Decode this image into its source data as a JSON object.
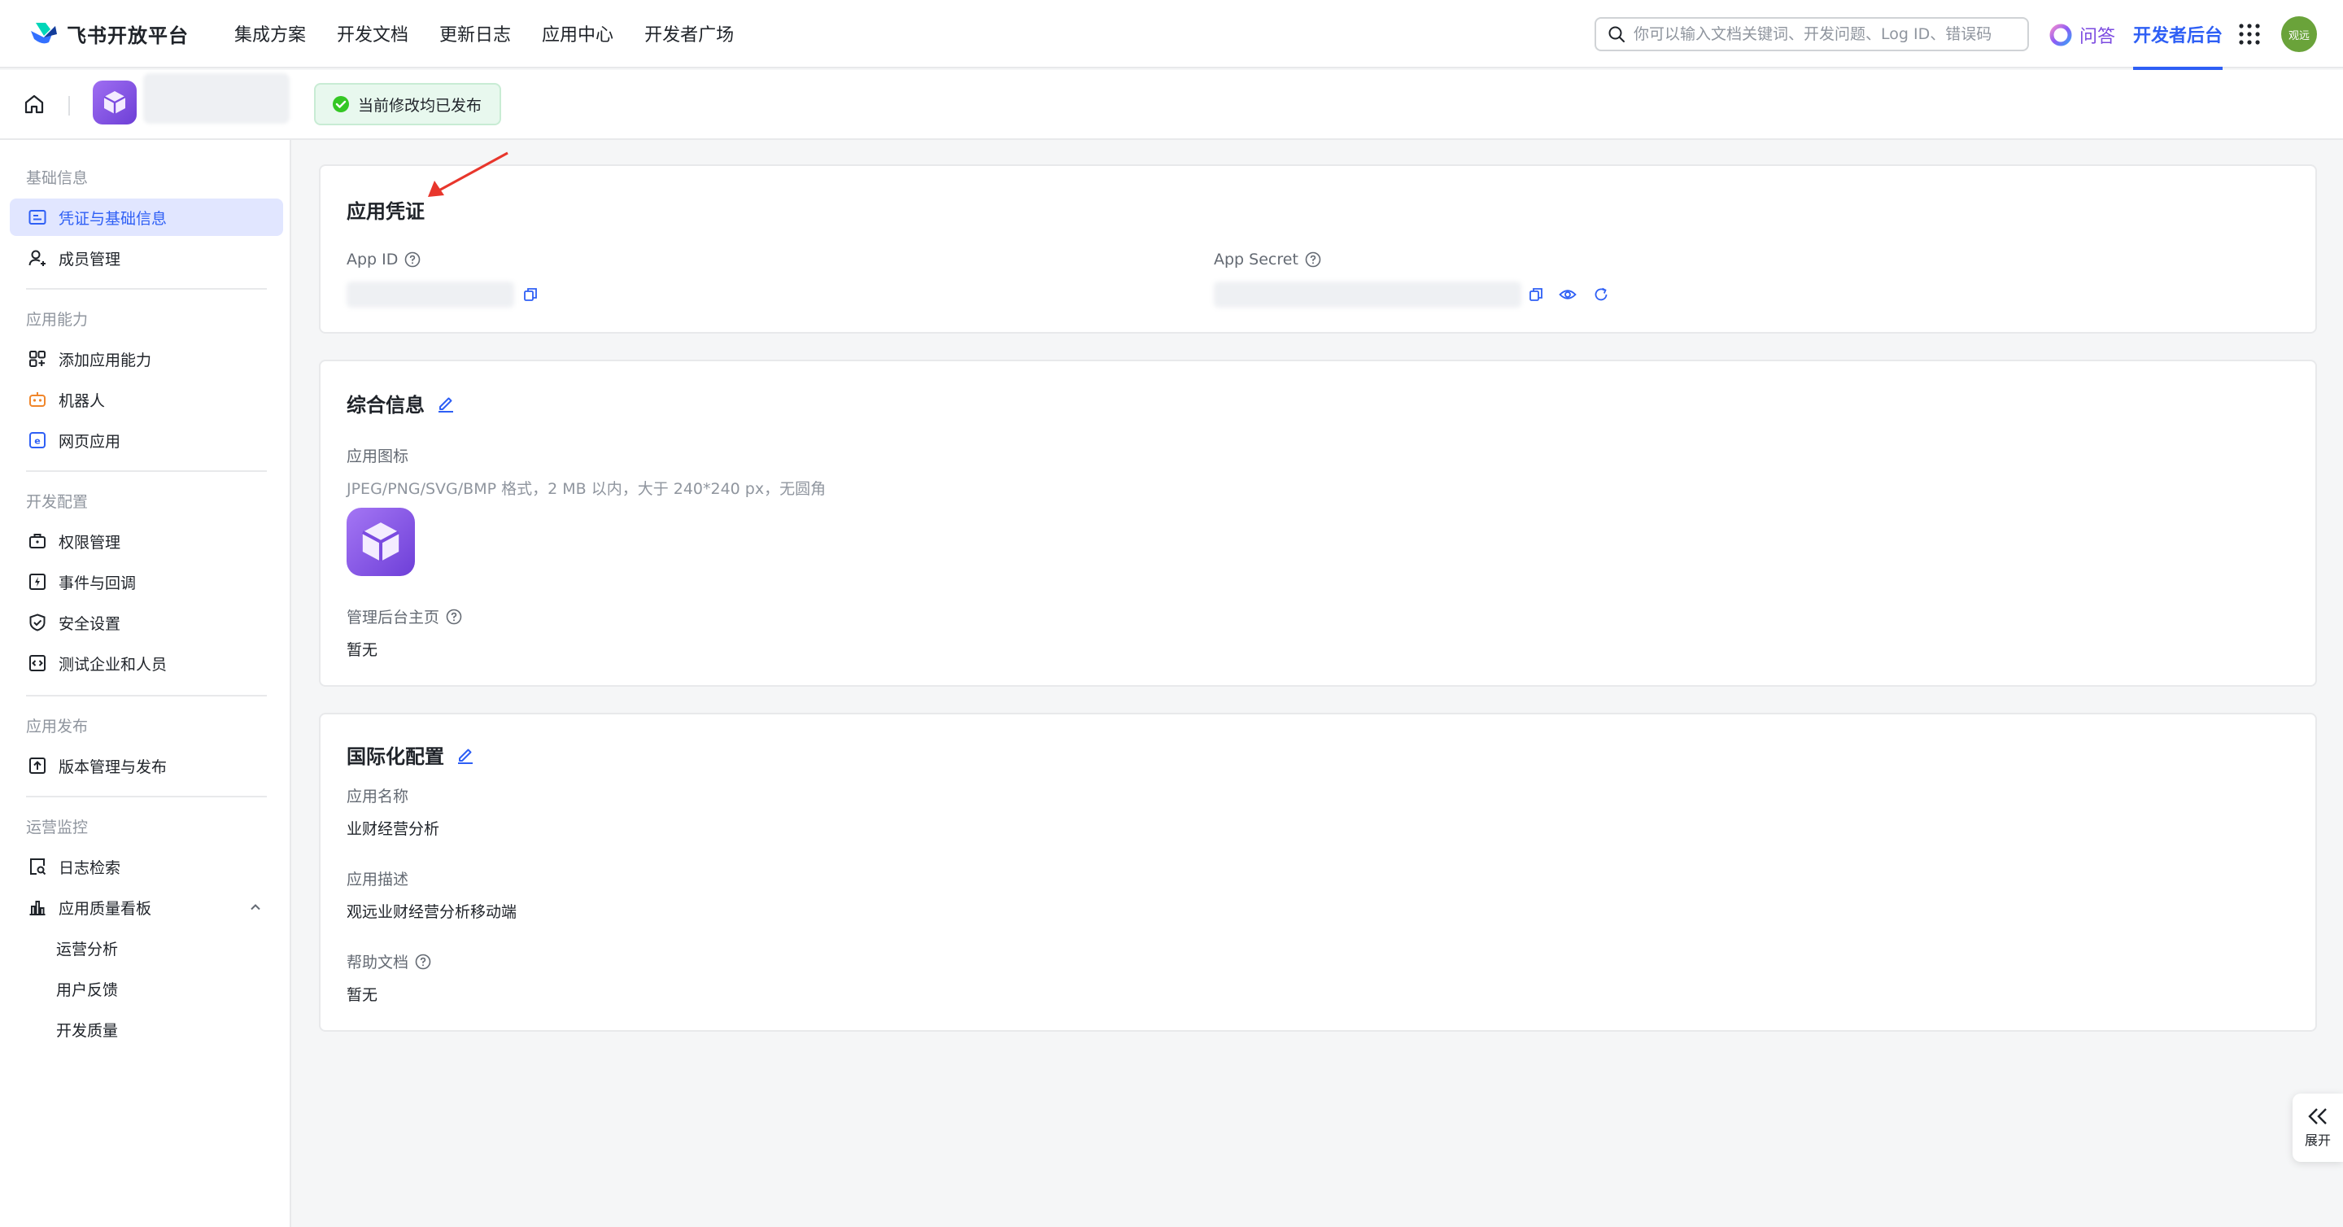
{
  "brand": {
    "name": "飞书开放平台"
  },
  "nav": {
    "links": [
      "集成方案",
      "开发文档",
      "更新日志",
      "应用中心",
      "开发者广场"
    ]
  },
  "search": {
    "placeholder": "你可以输入文档关键词、开发问题、Log ID、错误码"
  },
  "qa": {
    "label": "问答"
  },
  "dev_console": {
    "label": "开发者后台"
  },
  "user": {
    "avatar_text": "观远"
  },
  "subheader": {
    "status": "当前修改均已发布"
  },
  "sidebar": {
    "groups": [
      {
        "title": "基础信息",
        "items": [
          "凭证与基础信息",
          "成员管理"
        ]
      },
      {
        "title": "应用能力",
        "items": [
          "添加应用能力",
          "机器人",
          "网页应用"
        ]
      },
      {
        "title": "开发配置",
        "items": [
          "权限管理",
          "事件与回调",
          "安全设置",
          "测试企业和人员"
        ]
      },
      {
        "title": "应用发布",
        "items": [
          "版本管理与发布"
        ]
      },
      {
        "title": "运营监控",
        "items": [
          "日志检索",
          "应用质量看板"
        ],
        "subitems": [
          "运营分析",
          "用户反馈",
          "开发质量"
        ]
      }
    ],
    "active_item": "凭证与基础信息"
  },
  "credentials": {
    "title": "应用凭证",
    "app_id_label": "App ID",
    "app_secret_label": "App Secret"
  },
  "general": {
    "title": "综合信息",
    "icon_label": "应用图标",
    "icon_hint": "JPEG/PNG/SVG/BMP 格式，2 MB 以内，大于 240*240 px，无圆角",
    "admin_home_label": "管理后台主页",
    "admin_home_value": "暂无"
  },
  "i18n": {
    "title": "国际化配置",
    "name_label": "应用名称",
    "name_value": "业财经营分析",
    "desc_label": "应用描述",
    "desc_value": "观远业财经营分析移动端",
    "help_label": "帮助文档",
    "help_value": "暂无"
  },
  "expand": {
    "label": "展开"
  },
  "colors": {
    "accent": "#2e5ff5",
    "success": "#34c724",
    "app_icon": "#8a5cf0"
  }
}
